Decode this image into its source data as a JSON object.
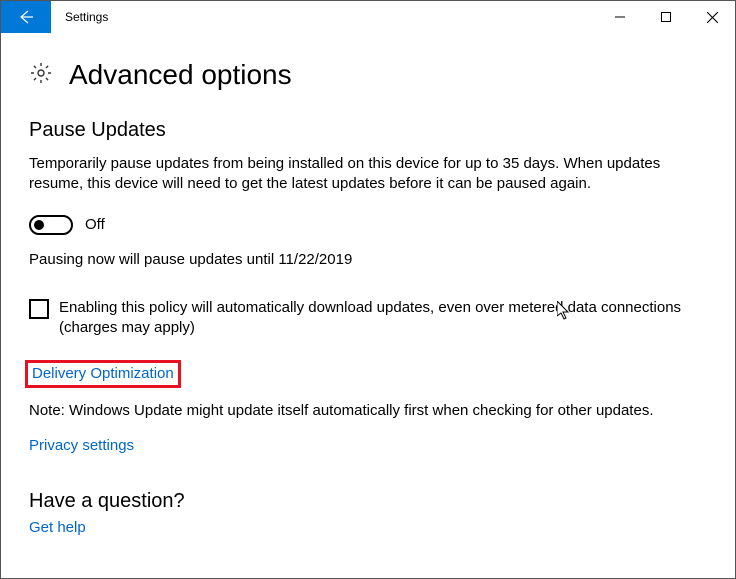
{
  "window": {
    "title": "Settings"
  },
  "page": {
    "title": "Advanced options"
  },
  "pause": {
    "heading": "Pause Updates",
    "description": "Temporarily pause updates from being installed on this device for up to 35 days. When updates resume, this device will need to get the latest updates before it can be paused again.",
    "toggle_state": "Off",
    "status": "Pausing now will pause updates until 11/22/2019"
  },
  "metered": {
    "label": "Enabling this policy will automatically download updates, even over metered data connections (charges may apply)"
  },
  "links": {
    "delivery_optimization": "Delivery Optimization",
    "privacy_settings": "Privacy settings",
    "get_help": "Get help"
  },
  "note": "Note: Windows Update might update itself automatically first when checking for other updates.",
  "question_heading": "Have a question?"
}
